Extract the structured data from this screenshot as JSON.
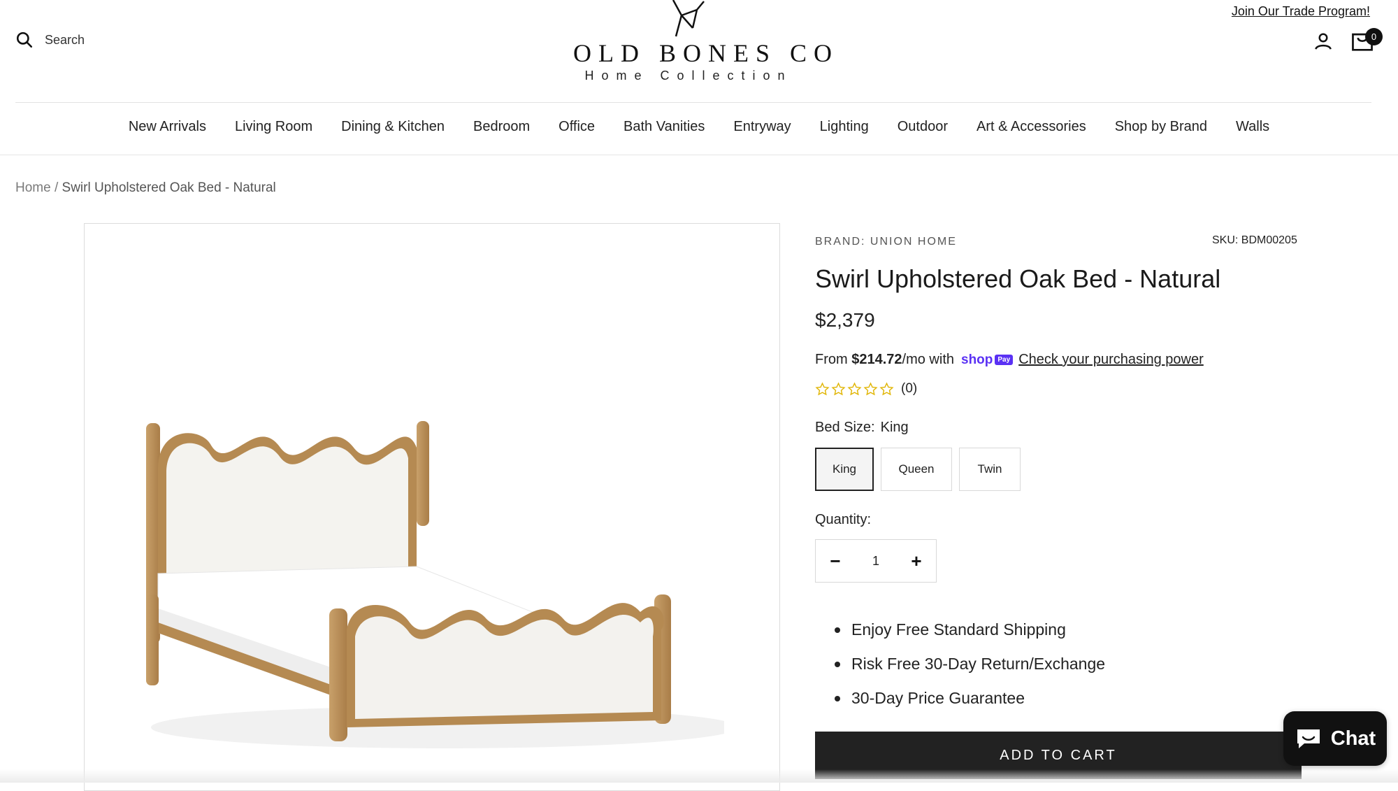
{
  "header": {
    "search_label": "Search",
    "logo_name": "OLD BONES CO",
    "logo_sub": "Home Collection",
    "trade_link": "Join Our Trade Program!",
    "cart_count": "0"
  },
  "nav": {
    "items": [
      {
        "label": "New Arrivals"
      },
      {
        "label": "Living Room"
      },
      {
        "label": "Dining & Kitchen"
      },
      {
        "label": "Bedroom"
      },
      {
        "label": "Office"
      },
      {
        "label": "Bath Vanities"
      },
      {
        "label": "Entryway"
      },
      {
        "label": "Lighting"
      },
      {
        "label": "Outdoor"
      },
      {
        "label": "Art & Accessories"
      },
      {
        "label": "Shop by Brand"
      },
      {
        "label": "Walls"
      }
    ]
  },
  "breadcrumb": {
    "home": "Home",
    "separator": "/",
    "current": "Swirl Upholstered Oak Bed - Natural"
  },
  "product": {
    "brand": "BRAND: UNION HOME",
    "sku": "SKU: BDM00205",
    "title": "Swirl Upholstered Oak Bed - Natural",
    "price": "$2,379",
    "installments": {
      "prefix": "From",
      "amount": "$214.72",
      "suffix": "/mo with",
      "shoppay_word": "shop",
      "shoppay_pay": "Pay",
      "link": "Check your purchasing power"
    },
    "rating": {
      "stars": 0,
      "max": 5,
      "count": "(0)"
    },
    "size": {
      "label": "Bed Size:",
      "selected": "King",
      "options": [
        {
          "label": "King",
          "active": true
        },
        {
          "label": "Queen",
          "active": false
        },
        {
          "label": "Twin",
          "active": false
        }
      ]
    },
    "quantity": {
      "label": "Quantity:",
      "value": "1",
      "minus": "−",
      "plus": "+"
    },
    "benefits": [
      "Enjoy Free Standard Shipping",
      "Risk Free 30-Day Return/Exchange",
      "30-Day Price Guarantee"
    ],
    "add_to_cart": "ADD TO CART"
  },
  "chat": {
    "label": "Chat"
  },
  "colors": {
    "shoppay": "#5a31f4",
    "button": "#222222",
    "star_outline": "#e0b400"
  },
  "icons": [
    "search-icon",
    "account-icon",
    "cart-icon",
    "star-icon",
    "chat-bubble-icon"
  ]
}
